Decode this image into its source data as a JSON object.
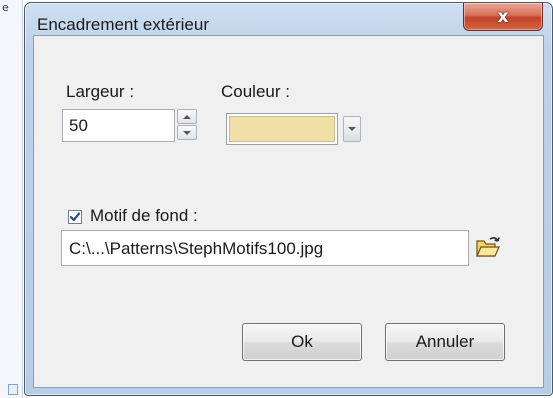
{
  "background": {
    "edge_char": "e"
  },
  "dialog": {
    "title": "Encadrement extérieur",
    "close_label": "x",
    "width_label": "Largeur :",
    "width_value": "50",
    "color_label": "Couleur :",
    "color_value": "#f0e0a8",
    "pattern_checked": true,
    "pattern_label": "Motif de fond :",
    "pattern_path": "C:\\...\\Patterns\\StephMotifs100.jpg",
    "ok_label": "Ok",
    "cancel_label": "Annuler"
  },
  "icons": {
    "close": "close-icon",
    "spin_up": "chevron-up-icon",
    "spin_down": "chevron-down-icon",
    "dropdown": "chevron-down-icon",
    "checkbox": "checkmark-icon",
    "browse": "open-folder-icon"
  }
}
